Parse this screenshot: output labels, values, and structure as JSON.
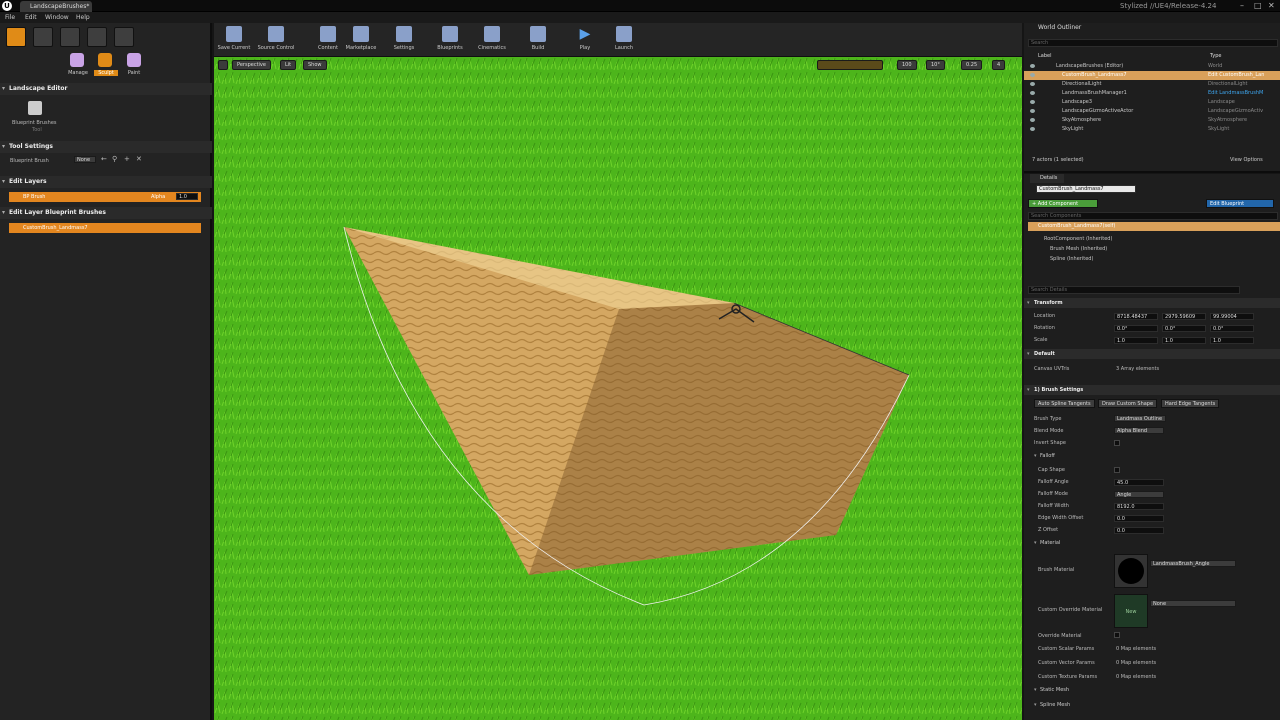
{
  "window": {
    "tab": "LandscapeBrushes*",
    "project": "Stylized //UE4/Release-4.24"
  },
  "menu": [
    "File",
    "Edit",
    "Window",
    "Help"
  ],
  "modes": {
    "labels": [
      "Manage",
      "Sculpt",
      "Paint"
    ],
    "editor_title": "Landscape Editor",
    "tool_name": "Blueprint Brushes",
    "tool_sub": "Tool",
    "tool_settings": "Tool Settings",
    "blueprint_brush_label": "Blueprint Brush",
    "blueprint_brush_value": "None",
    "edit_layers": "Edit Layers",
    "layer_name": "BP Brush",
    "alpha_label": "Alpha",
    "alpha_value": "1.0",
    "edit_layer_bp": "Edit Layer Blueprint Brushes",
    "bp_brush_item": "CustomBrush_Landmass7"
  },
  "toolbar": [
    "Save Current",
    "Source Control",
    "Content",
    "Marketplace",
    "Settings",
    "Blueprints",
    "Cinematics",
    "Build",
    "Play",
    "Launch"
  ],
  "viewport": {
    "perspective": "Perspective",
    "lit": "Lit",
    "show": "Show",
    "grid": "100",
    "angle": "10°",
    "scale": "0.25",
    "cam": "4"
  },
  "outliner": {
    "title": "World Outliner",
    "search": "Search",
    "col_label": "Label",
    "col_type": "Type",
    "rows": [
      {
        "label": "LandscapeBrushes (Editor)",
        "type": "World"
      },
      {
        "label": "CustomBrush_Landmass7",
        "type": "Edit CustomBrush_Lan"
      },
      {
        "label": "DirectionalLight",
        "type": "DirectionalLight"
      },
      {
        "label": "LandmassBrushManager1",
        "type": "Edit LandmassBrushM"
      },
      {
        "label": "Landscape3",
        "type": "Landscape"
      },
      {
        "label": "LandscapeGizmoActiveActor",
        "type": "LandscapeGizmoActiv"
      },
      {
        "label": "SkyAtmosphere",
        "type": "SkyAtmosphere"
      },
      {
        "label": "SkyLight",
        "type": "SkyLight"
      }
    ],
    "count": "7 actors (1 selected)",
    "view_options": "View Options"
  },
  "details": {
    "title": "Details",
    "actor_name": "CustomBrush_Landmass7",
    "add_component": "+ Add Component",
    "edit_blueprint": "Edit Blueprint",
    "search_components": "Search Components",
    "comp_self": "CustomBrush_Landmass7(self)",
    "comp_root": "RootComponent (Inherited)",
    "comp_mesh": "Brush Mesh (Inherited)",
    "comp_spline": "Spline (Inherited)",
    "search_details": "Search Details",
    "transform": "Transform",
    "location": "Location",
    "rotation": "Rotation",
    "scale": "Scale",
    "loc": [
      "8718.48437",
      "2979.59609",
      "99.99004"
    ],
    "rot": [
      "0.0°",
      "0.0°",
      "0.0°"
    ],
    "scl": [
      "1.0",
      "1.0",
      "1.0"
    ],
    "default": "Default",
    "canvas_uvtris": "Canvas UVTris",
    "canvas_value": "3 Array elements",
    "brush_settings": "1) Brush Settings",
    "auto_spline": "Auto Spline Tangents",
    "draw_custom": "Draw Custom Shape",
    "hard_edge": "Hard Edge Tangents",
    "brush_type": "Brush Type",
    "brush_type_val": "Landmass Outline",
    "blend_mode": "Blend Mode",
    "blend_mode_val": "Alpha Blend",
    "invert_shape": "Invert Shape",
    "falloff": "Falloff",
    "cap_shape": "Cap Shape",
    "falloff_angle": "Falloff Angle",
    "falloff_angle_val": "45.0",
    "falloff_mode": "Falloff Mode",
    "falloff_mode_val": "Angle",
    "falloff_width": "Falloff Width",
    "falloff_width_val": "8192.0",
    "edge_width": "Edge Width Offset",
    "edge_width_val": "0.0",
    "z_offset": "Z Offset",
    "z_offset_val": "0.0",
    "material": "Material",
    "brush_material": "Brush Material",
    "brush_material_val": "LandmassBrush_Angle",
    "custom_override": "Custom Override Material",
    "custom_override_val": "None",
    "thumb_new": "New",
    "override_material": "Override Material",
    "scalar": "Custom Scalar Params",
    "vector": "Custom Vector Params",
    "texture": "Custom Texture Params",
    "map_elements": "0 Map elements",
    "static_mesh": "Static Mesh",
    "spline_mesh": "Spline Mesh"
  }
}
